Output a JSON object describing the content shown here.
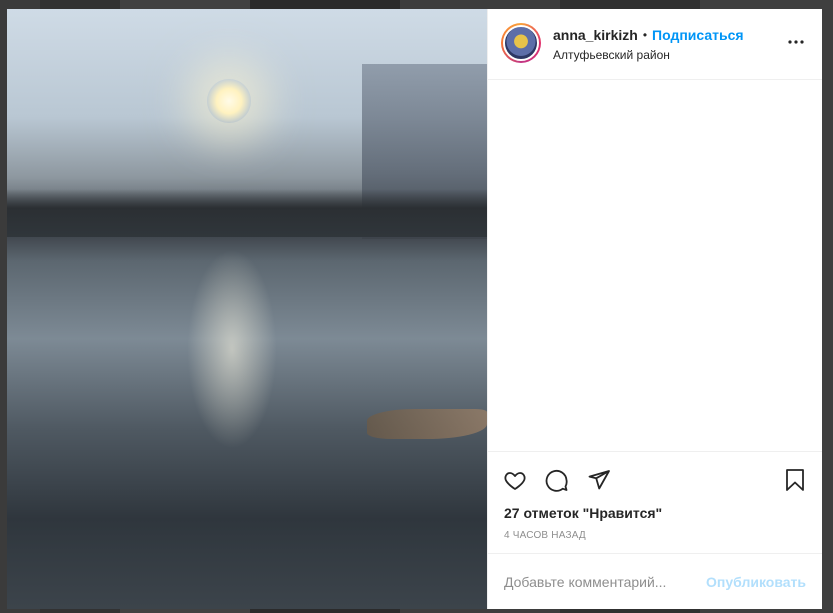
{
  "post": {
    "username": "anna_kirkizh",
    "separator": "•",
    "follow_label": "Подписаться",
    "location": "Алтуфьевский район"
  },
  "engagement": {
    "likes_text": "27 отметок \"Нравится\"",
    "time_text": "4 часов назад"
  },
  "comment": {
    "placeholder": "Добавьте комментарий...",
    "publish_label": "Опубликовать"
  },
  "icons": {
    "more": "more-options-icon",
    "like": "heart-icon",
    "comment": "comment-icon",
    "share": "paper-plane-icon",
    "save": "bookmark-icon"
  },
  "colors": {
    "accent": "#0095f6",
    "publish_disabled": "#b2dffc",
    "text": "#262626",
    "muted": "#8e8e8e"
  }
}
